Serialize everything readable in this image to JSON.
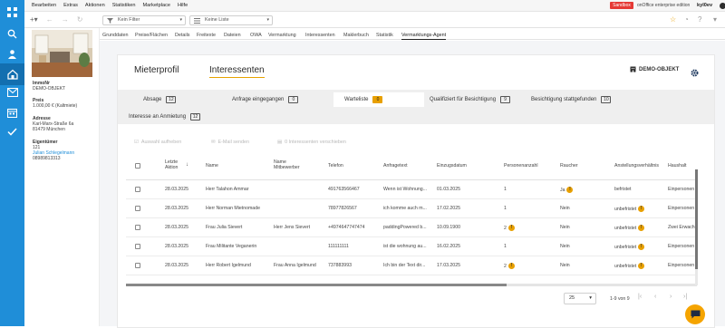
{
  "menu": [
    "Bearbeiten",
    "Extras",
    "Aktionen",
    "Statistiken",
    "Marketplace",
    "Hilfe"
  ],
  "topbar": {
    "sandbox": "Sandbox",
    "edition": "onOffice enterprise edition",
    "user": "kyl0ev"
  },
  "toolbar": {
    "filter": "Kein Filter",
    "list": "Keine Liste"
  },
  "listing": {
    "immonr_label": "ImmoNr",
    "immonr": "DEMO-OBJEKT",
    "preis_label": "Preis",
    "preis": "1.000,00 € (Kaltmiete)",
    "adresse_label": "Adresse",
    "adresse1": "Karl-Marx-Straße 6a",
    "adresse2": "81479 München",
    "eigentuemer_label": "Eigentümer",
    "eig_nr": "121",
    "eig_name": "Julian Schlegelmann",
    "eig_tel": "08989813313"
  },
  "tabs": [
    "Grunddaten",
    "Preise/Flächen",
    "Details",
    "Freitexte",
    "Dateien",
    "OWA",
    "Vermarktung",
    "Interessenten",
    "Maklerbuch",
    "Statistik",
    "Vermarktungs-Agent"
  ],
  "subtabs": [
    "Mieterprofil",
    "Interessenten"
  ],
  "object_label": "DEMO-OBJEKT",
  "stages": [
    {
      "label": "Absage",
      "count": "12"
    },
    {
      "label": "Anfrage eingegangen",
      "count": "0"
    },
    {
      "label": "Warteliste",
      "count": "0"
    },
    {
      "label": "Qualifiziert für Besichtigung",
      "count": "9"
    },
    {
      "label": "Besichtigung stattgefunden",
      "count": "10"
    },
    {
      "label": "Interesse an Anmietung",
      "count": "12"
    }
  ],
  "actions": [
    "Auswahl aufheben",
    "E-Mail senden",
    "0 Interessenten verschieben"
  ],
  "columns": [
    "Letzte Aktion",
    "Name",
    "Name Mitbewerber",
    "Telefon",
    "Anfragetext",
    "Einzugsdatum",
    "Personenanzahl",
    "Raucher",
    "Anstellungsverhältnis",
    "Haushalt"
  ],
  "rows": [
    {
      "date": "28.03.2025",
      "name": "Herr Talahon Ammar",
      "mit": "",
      "tel": "491763566467",
      "text": "Wenn ist Wohnung...",
      "einzug": "01.03.2025",
      "pers": "1",
      "pdot": "",
      "rauch": "Ja",
      "rdot": "!",
      "anst": "befristet",
      "adot": "",
      "haus": "Einpersonen"
    },
    {
      "date": "28.03.2025",
      "name": "Herr Norman Mietnomade",
      "mit": "",
      "tel": "78977826567",
      "text": "ich komme auch m...",
      "einzug": "17.02.2025",
      "pers": "1",
      "pdot": "",
      "rauch": "Nein",
      "rdot": "",
      "anst": "unbefristet",
      "adot": "!",
      "haus": "Einpersonen"
    },
    {
      "date": "28.03.2025",
      "name": "Frau Julia Sievert",
      "mit": "Herr Jens Sievert",
      "tel": "+4974647747474",
      "text": "paddingPowered b...",
      "einzug": "10.09.1900",
      "pers": "2",
      "pdot": "!",
      "rauch": "Nein",
      "rdot": "",
      "anst": "unbefristet",
      "adot": "!",
      "haus": "Zwei Erwach"
    },
    {
      "date": "28.03.2025",
      "name": "Frau Militante Veganerin",
      "mit": "",
      "tel": "111111111",
      "text": "ist die wohnung au...",
      "einzug": "16.02.2025",
      "pers": "1",
      "pdot": "",
      "rauch": "Nein",
      "rdot": "",
      "anst": "unbefristet",
      "adot": "!",
      "haus": "Einpersonen"
    },
    {
      "date": "28.03.2025",
      "name": "Herr Robert Igelmund",
      "mit": "Frau Anna Igelmund",
      "tel": "737883993",
      "text": "Ich bin der Text dir...",
      "einzug": "17.03.2025",
      "pers": "2",
      "pdot": "!",
      "rauch": "Nein",
      "rdot": "",
      "anst": "unbefristet",
      "adot": "!",
      "haus": "Einpersonen"
    }
  ],
  "pagination": {
    "per_page": "25",
    "info": "1-9 von 9"
  },
  "colors": {
    "accent": "#1f8ed8",
    "warning": "#e8a000",
    "sandbox": "#e53935"
  }
}
